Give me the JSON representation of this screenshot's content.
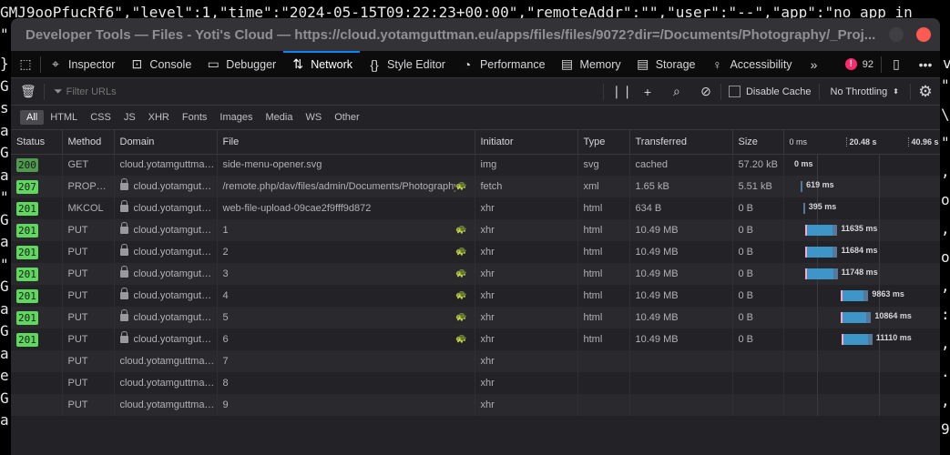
{
  "terminal": {
    "top_line": "GMJ9ooPfucRf6\",\"level\":1,\"time\":\"2024-05-15T09:22:23+00:00\",\"remoteAddr\":\"\",\"user\":\"--\",\"app\":\"no app in",
    "second_line_left": "\"",
    "second_line_right": "ve",
    "left_chars": [
      "}",
      "G",
      "s",
      "a",
      "G",
      "a",
      "\"",
      "G",
      "a",
      "\"",
      "G",
      "a",
      "G",
      "a",
      "e",
      "G",
      "a"
    ],
    "right_chars": [
      "\"",
      "\\(",
      "\"s",
      ",",
      "or",
      ",",
      "or",
      ",",
      ":",
      ",",
      ".(",
      ",",
      "9"
    ]
  },
  "window": {
    "title": "Developer Tools — Files - Yoti's Cloud — https://cloud.yotamguttman.eu/apps/files/files/9072?dir=/Documents/Photography/_Proj..."
  },
  "tabs": [
    "Inspector",
    "Console",
    "Debugger",
    "Network",
    "Style Editor",
    "Performance",
    "Memory",
    "Storage",
    "Accessibility"
  ],
  "error_count": "92",
  "filter": {
    "placeholder": "Filter URLs",
    "disable_cache": "Disable Cache",
    "throttling": "No Throttling"
  },
  "type_filters": [
    "All",
    "HTML",
    "CSS",
    "JS",
    "XHR",
    "Fonts",
    "Images",
    "Media",
    "WS",
    "Other"
  ],
  "columns": [
    "Status",
    "Method",
    "Domain",
    "File",
    "Initiator",
    "Type",
    "Transferred",
    "Size"
  ],
  "waterfall_ticks": [
    "0 ms",
    "20.48 s",
    "40.96 s"
  ],
  "rows": [
    {
      "status": "200",
      "cached": true,
      "method": "GET",
      "secure": false,
      "domain": "cloud.yotamguttma…",
      "file": "side-menu-opener.svg",
      "slow": false,
      "initiator": "img",
      "type": "svg",
      "transferred": "cached",
      "size": "57.20 kB",
      "start_s": 0,
      "duration_s": 0,
      "timing": "0 ms"
    },
    {
      "status": "207",
      "method": "PROP…",
      "secure": true,
      "domain": "cloud.yotamgut…",
      "file": "/remote.php/dav/files/admin/Documents/Photography",
      "slow": true,
      "initiator": "fetch",
      "type": "xml",
      "transferred": "1.65 kB",
      "size": "5.51 kB",
      "start_s": 4.2,
      "duration_s": 0.619,
      "timing": "619 ms"
    },
    {
      "status": "201",
      "method": "MKCOL",
      "secure": true,
      "domain": "cloud.yotamgut…",
      "file": "web-file-upload-09cae2f9fff9d872",
      "slow": false,
      "initiator": "xhr",
      "type": "html",
      "transferred": "634 B",
      "size": "0 B",
      "start_s": 5.2,
      "duration_s": 0.395,
      "timing": "395 ms"
    },
    {
      "status": "201",
      "method": "PUT",
      "secure": true,
      "domain": "cloud.yotamgut…",
      "file": "1",
      "slow": true,
      "initiator": "xhr",
      "type": "html",
      "transferred": "10.49 MB",
      "size": "0 B",
      "start_s": 5.8,
      "duration_s": 11.635,
      "timing": "11635 ms"
    },
    {
      "status": "201",
      "method": "PUT",
      "secure": true,
      "domain": "cloud.yotamgut…",
      "file": "2",
      "slow": true,
      "initiator": "xhr",
      "type": "html",
      "transferred": "10.49 MB",
      "size": "0 B",
      "start_s": 5.8,
      "duration_s": 11.684,
      "timing": "11684 ms"
    },
    {
      "status": "201",
      "method": "PUT",
      "secure": true,
      "domain": "cloud.yotamgut…",
      "file": "3",
      "slow": true,
      "initiator": "xhr",
      "type": "html",
      "transferred": "10.49 MB",
      "size": "0 B",
      "start_s": 5.8,
      "duration_s": 11.748,
      "timing": "11748 ms"
    },
    {
      "status": "201",
      "method": "PUT",
      "secure": true,
      "domain": "cloud.yotamgut…",
      "file": "4",
      "slow": true,
      "initiator": "xhr",
      "type": "html",
      "transferred": "10.49 MB",
      "size": "0 B",
      "start_s": 18.8,
      "duration_s": 9.863,
      "timing": "9863 ms"
    },
    {
      "status": "201",
      "method": "PUT",
      "secure": true,
      "domain": "cloud.yotamgut…",
      "file": "5",
      "slow": true,
      "initiator": "xhr",
      "type": "html",
      "transferred": "10.49 MB",
      "size": "0 B",
      "start_s": 18.8,
      "duration_s": 10.864,
      "timing": "10864 ms"
    },
    {
      "status": "201",
      "method": "PUT",
      "secure": true,
      "domain": "cloud.yotamgut…",
      "file": "6",
      "slow": true,
      "initiator": "xhr",
      "type": "html",
      "transferred": "10.49 MB",
      "size": "0 B",
      "start_s": 19.0,
      "duration_s": 11.11,
      "timing": "11110 ms"
    },
    {
      "status": "",
      "method": "PUT",
      "secure": false,
      "domain": "cloud.yotamguttma…",
      "file": "7",
      "slow": false,
      "initiator": "xhr",
      "type": "",
      "transferred": "",
      "size": ""
    },
    {
      "status": "",
      "method": "PUT",
      "secure": false,
      "domain": "cloud.yotamguttma…",
      "file": "8",
      "slow": false,
      "initiator": "xhr",
      "type": "",
      "transferred": "",
      "size": ""
    },
    {
      "status": "",
      "method": "PUT",
      "secure": false,
      "domain": "cloud.yotamguttma…",
      "file": "9",
      "slow": false,
      "initiator": "xhr",
      "type": "",
      "transferred": "",
      "size": ""
    }
  ]
}
